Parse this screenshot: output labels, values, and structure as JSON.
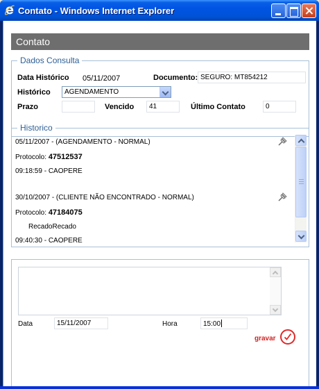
{
  "window": {
    "title": "Contato - Windows Internet Explorer"
  },
  "header": {
    "title": "Contato"
  },
  "dados_consulta": {
    "legend": "Dados Consulta",
    "data_historico_label": "Data Histórico",
    "data_historico_value": "05/11/2007",
    "documento_label": "Documento:",
    "documento_value": "SEGURO: MT854212",
    "historico_label": "Histórico",
    "historico_selected": "AGENDAMENTO",
    "prazo_label": "Prazo",
    "prazo_value": "",
    "vencido_label": "Vencido",
    "vencido_value": "41",
    "ultimo_contato_label": "Último Contato",
    "ultimo_contato_value": "0"
  },
  "historico": {
    "legend": "Historico",
    "entries": [
      {
        "header": "05/11/2007 - (AGENDAMENTO - NORMAL)",
        "protocol_label": "Protocolo:",
        "protocol_value": "47512537",
        "note": "",
        "footer": "09:18:59 - CAOPERE"
      },
      {
        "header": "30/10/2007 - (CLIENTE NÃO ENCONTRADO - NORMAL)",
        "protocol_label": "Protocolo:",
        "protocol_value": "47184075",
        "note": "RecadoRecado",
        "footer": "09:40:30 - CAOPERE"
      }
    ]
  },
  "form": {
    "observacao_value": "",
    "data_label": "Data",
    "data_value": "15/11/2007",
    "hora_label": "Hora",
    "hora_value": "15:00",
    "gravar_label": "gravar"
  },
  "colors": {
    "title_bar": "#0054e3",
    "header_bar": "#6e6e6e",
    "legend_text": "#2d5f96",
    "gravar": "#d52121"
  },
  "icons": {
    "browser": "ie-icon",
    "pin": "pin-icon",
    "confirm": "checkmark-icon"
  }
}
